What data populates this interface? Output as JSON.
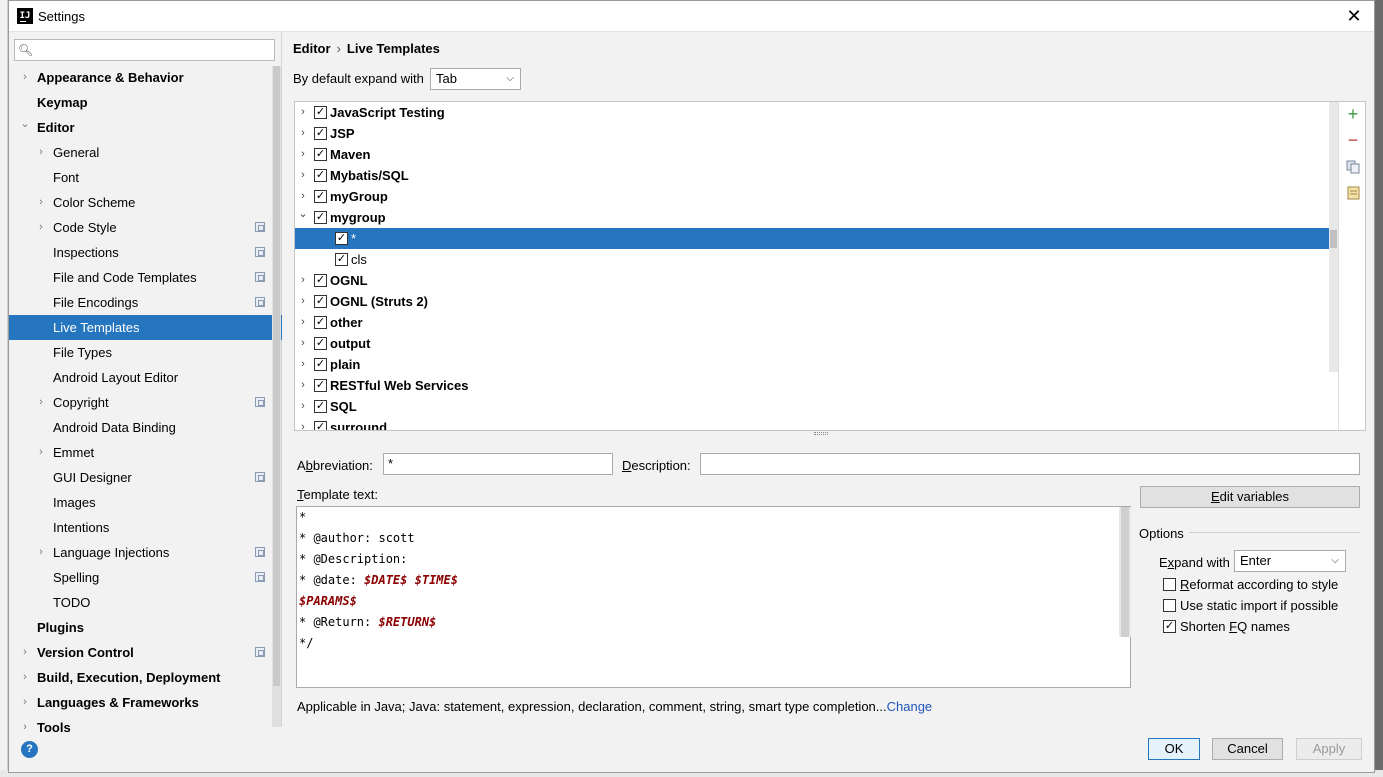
{
  "window": {
    "title": "Settings",
    "close_label": "✕"
  },
  "search": {
    "placeholder": ""
  },
  "sidebar": {
    "items": [
      {
        "label": "Appearance & Behavior",
        "level": 0,
        "expandable": true,
        "expanded": false,
        "project": false
      },
      {
        "label": "Keymap",
        "level": 0,
        "expandable": false,
        "project": false
      },
      {
        "label": "Editor",
        "level": 0,
        "expandable": true,
        "expanded": true,
        "project": false
      },
      {
        "label": "General",
        "level": 1,
        "expandable": true,
        "project": false
      },
      {
        "label": "Font",
        "level": 1,
        "expandable": false,
        "project": false
      },
      {
        "label": "Color Scheme",
        "level": 1,
        "expandable": true,
        "project": false
      },
      {
        "label": "Code Style",
        "level": 1,
        "expandable": true,
        "project": true
      },
      {
        "label": "Inspections",
        "level": 1,
        "expandable": false,
        "project": true
      },
      {
        "label": "File and Code Templates",
        "level": 1,
        "expandable": false,
        "project": true
      },
      {
        "label": "File Encodings",
        "level": 1,
        "expandable": false,
        "project": true
      },
      {
        "label": "Live Templates",
        "level": 1,
        "expandable": false,
        "project": false,
        "selected": true
      },
      {
        "label": "File Types",
        "level": 1,
        "expandable": false,
        "project": false
      },
      {
        "label": "Android Layout Editor",
        "level": 1,
        "expandable": false,
        "project": false
      },
      {
        "label": "Copyright",
        "level": 1,
        "expandable": true,
        "project": true
      },
      {
        "label": "Android Data Binding",
        "level": 1,
        "expandable": false,
        "project": false
      },
      {
        "label": "Emmet",
        "level": 1,
        "expandable": true,
        "project": false
      },
      {
        "label": "GUI Designer",
        "level": 1,
        "expandable": false,
        "project": true
      },
      {
        "label": "Images",
        "level": 1,
        "expandable": false,
        "project": false
      },
      {
        "label": "Intentions",
        "level": 1,
        "expandable": false,
        "project": false
      },
      {
        "label": "Language Injections",
        "level": 1,
        "expandable": true,
        "project": true
      },
      {
        "label": "Spelling",
        "level": 1,
        "expandable": false,
        "project": true
      },
      {
        "label": "TODO",
        "level": 1,
        "expandable": false,
        "project": false
      },
      {
        "label": "Plugins",
        "level": 0,
        "expandable": false,
        "project": false
      },
      {
        "label": "Version Control",
        "level": 0,
        "expandable": true,
        "project": true
      },
      {
        "label": "Build, Execution, Deployment",
        "level": 0,
        "expandable": true,
        "project": false
      },
      {
        "label": "Languages & Frameworks",
        "level": 0,
        "expandable": true,
        "project": false
      },
      {
        "label": "Tools",
        "level": 0,
        "expandable": true,
        "project": false
      }
    ]
  },
  "breadcrumb": {
    "parent": "Editor",
    "separator": "›",
    "current": "Live Templates"
  },
  "expand_default": {
    "label": "By default expand with",
    "value": "Tab"
  },
  "templates": [
    {
      "label": "JavaScript Testing",
      "kind": "group",
      "checked": true,
      "expanded": false
    },
    {
      "label": "JSP",
      "kind": "group",
      "checked": true,
      "expanded": false
    },
    {
      "label": "Maven",
      "kind": "group",
      "checked": true,
      "expanded": false
    },
    {
      "label": "Mybatis/SQL",
      "kind": "group",
      "checked": true,
      "expanded": false
    },
    {
      "label": "myGroup",
      "kind": "group",
      "checked": true,
      "expanded": false
    },
    {
      "label": "mygroup",
      "kind": "group",
      "checked": true,
      "expanded": true
    },
    {
      "label": "*",
      "kind": "child",
      "checked": true,
      "selected": true
    },
    {
      "label": "cls",
      "kind": "child",
      "checked": true
    },
    {
      "label": "OGNL",
      "kind": "group",
      "checked": true,
      "expanded": false
    },
    {
      "label": "OGNL (Struts 2)",
      "kind": "group",
      "checked": true,
      "expanded": false
    },
    {
      "label": "other",
      "kind": "group",
      "checked": true,
      "expanded": false
    },
    {
      "label": "output",
      "kind": "group",
      "checked": true,
      "expanded": false
    },
    {
      "label": "plain",
      "kind": "group",
      "checked": true,
      "expanded": false
    },
    {
      "label": "RESTful Web Services",
      "kind": "group",
      "checked": true,
      "expanded": false
    },
    {
      "label": "SQL",
      "kind": "group",
      "checked": true,
      "expanded": false
    },
    {
      "label": "surround",
      "kind": "group",
      "checked": true,
      "expanded": false
    }
  ],
  "toolbar": {
    "add": "+",
    "remove": "−",
    "copy": "copy-icon",
    "restore": "restore-icon"
  },
  "abbreviation": {
    "label_pre": "A",
    "label_u": "b",
    "label_post": "breviation:",
    "value": "*"
  },
  "description": {
    "label_pre": "",
    "label_u": "D",
    "label_post": "escription:",
    "value": ""
  },
  "template_text": {
    "label_u": "T",
    "label_post": "emplate text:",
    "lines": [
      {
        "segments": [
          {
            "t": "*",
            "v": false
          }
        ]
      },
      {
        "segments": [
          {
            "t": "* @author: scott",
            "v": false
          }
        ]
      },
      {
        "segments": [
          {
            "t": "* @Description:",
            "v": false
          }
        ]
      },
      {
        "segments": [
          {
            "t": "* @date: ",
            "v": false
          },
          {
            "t": "$DATE$",
            "v": true
          },
          {
            "t": " ",
            "v": false
          },
          {
            "t": "$TIME$",
            "v": true
          }
        ]
      },
      {
        "segments": [
          {
            "t": "$PARAMS$",
            "v": true
          }
        ]
      },
      {
        "segments": [
          {
            "t": "* @Return: ",
            "v": false
          },
          {
            "t": "$RETURN$",
            "v": true
          }
        ]
      },
      {
        "segments": [
          {
            "t": "*/",
            "v": false
          }
        ]
      }
    ]
  },
  "edit_variables": {
    "label_u": "E",
    "label_post": "dit variables"
  },
  "options": {
    "title": "Options",
    "expand_label_u": "x",
    "expand_label_pre": "E",
    "expand_label_post": "pand with",
    "expand_value": "Enter",
    "reformat": {
      "label_u": "R",
      "label_post": "eformat according to style",
      "checked": false
    },
    "static_import": {
      "label": "Use static import if possible",
      "checked": false
    },
    "shorten": {
      "label_pre": "Shorten ",
      "label_u": "F",
      "label_post": "Q names",
      "checked": true
    }
  },
  "applicable": {
    "text": "Applicable in Java; Java: statement, expression, declaration, comment, string, smart type completion...",
    "link": "Change"
  },
  "buttons": {
    "ok": "OK",
    "cancel": "Cancel",
    "apply": "Apply"
  },
  "help": "?"
}
